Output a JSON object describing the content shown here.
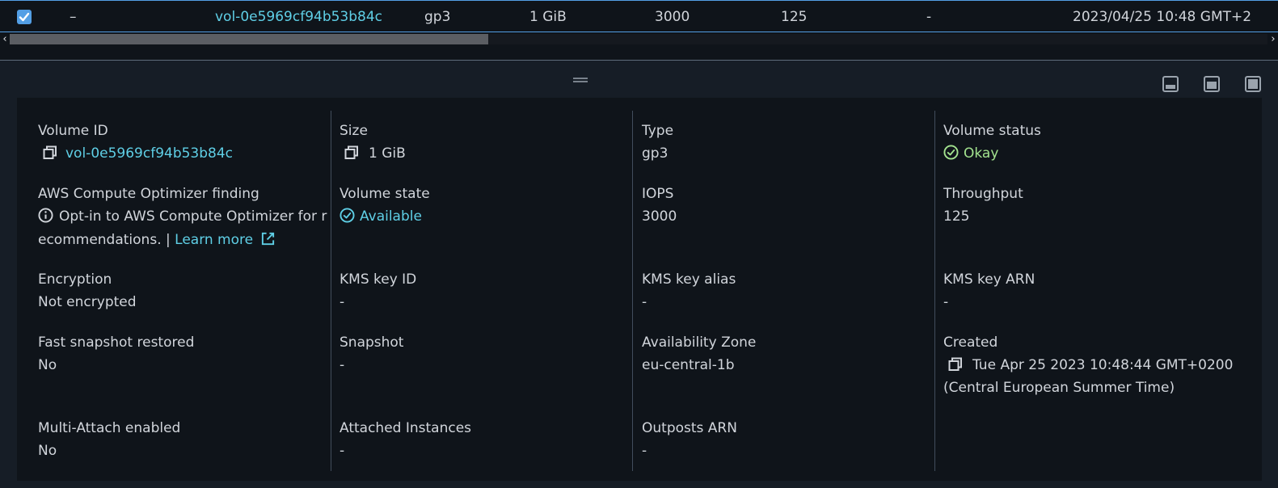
{
  "table_row": {
    "selected": true,
    "name": "–",
    "volume_id": "vol-0e5969cf94b53b84c",
    "type": "gp3",
    "size": "1 GiB",
    "iops": "3000",
    "throughput": "125",
    "snapshot": "-",
    "created": "2023/04/25 10:48 GMT+2"
  },
  "scrollbar": {
    "left_arrow": "‹",
    "right_arrow": "›"
  },
  "details": {
    "volume_id": {
      "label": "Volume ID",
      "value": "vol-0e5969cf94b53b84c"
    },
    "size": {
      "label": "Size",
      "value": "1 GiB"
    },
    "type": {
      "label": "Type",
      "value": "gp3"
    },
    "volume_status": {
      "label": "Volume status",
      "value": "Okay"
    },
    "compute_optimizer": {
      "label": "AWS Compute Optimizer finding",
      "line1": "Opt-in to AWS Compute Optimizer for r",
      "line2": "ecommendations. |",
      "link": "Learn more"
    },
    "volume_state": {
      "label": "Volume state",
      "value": "Available"
    },
    "iops": {
      "label": "IOPS",
      "value": "3000"
    },
    "throughput": {
      "label": "Throughput",
      "value": "125"
    },
    "encryption": {
      "label": "Encryption",
      "value": "Not encrypted"
    },
    "kms_key_id": {
      "label": "KMS key ID",
      "value": "-"
    },
    "kms_key_alias": {
      "label": "KMS key alias",
      "value": "-"
    },
    "kms_key_arn": {
      "label": "KMS key ARN",
      "value": "-"
    },
    "fast_snapshot": {
      "label": "Fast snapshot restored",
      "value": "No"
    },
    "snapshot": {
      "label": "Snapshot",
      "value": "-"
    },
    "availability_zone": {
      "label": "Availability Zone",
      "value": "eu-central-1b"
    },
    "created": {
      "label": "Created",
      "line1": "Tue Apr 25 2023 10:48:44 GMT+0200",
      "line2": "(Central European Summer Time)"
    },
    "multi_attach": {
      "label": "Multi-Attach enabled",
      "value": "No"
    },
    "attached_instances": {
      "label": "Attached Instances",
      "value": "-"
    },
    "outposts_arn": {
      "label": "Outposts ARN",
      "value": "-"
    }
  },
  "colors": {
    "link": "#5fcfe6",
    "success": "#a3e38f",
    "selection": "#539fe5",
    "background": "#0f141a"
  },
  "icons": [
    "checkbox-checked-icon",
    "copy-icon",
    "status-success-icon",
    "status-info-icon",
    "external-link-icon",
    "drag-handle-icon",
    "panel-bottom-icon",
    "panel-side-icon",
    "panel-full-icon"
  ]
}
